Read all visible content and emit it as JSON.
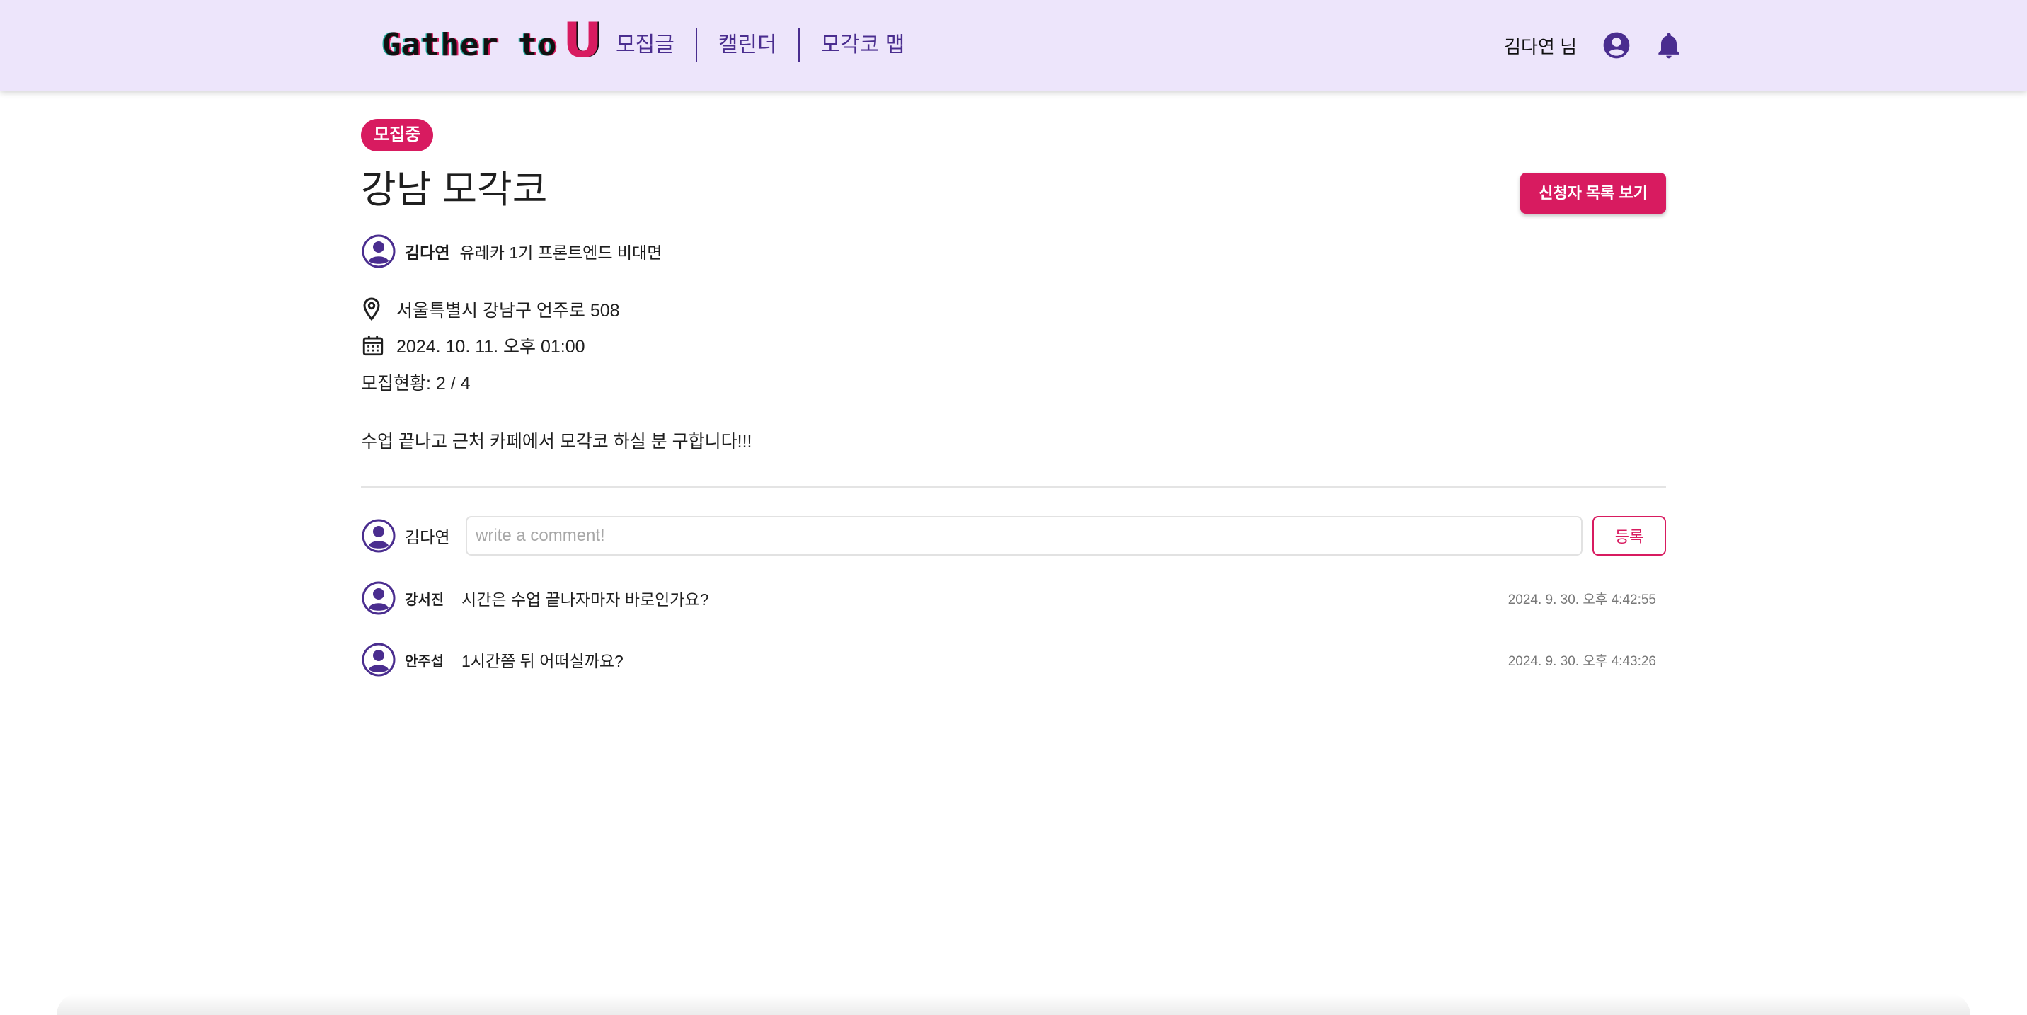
{
  "header": {
    "logo_text": "Gather to",
    "logo_accent": "U",
    "nav": [
      "모집글",
      "캘린더",
      "모각코 맵"
    ],
    "user_label": "김다연 님",
    "profile_icon": "account-circle-icon",
    "notification_icon": "bell-icon"
  },
  "post": {
    "status": "모집중",
    "title": "강남 모각코",
    "applicants_button": "신청자 목록 보기",
    "author": {
      "name": "김다연",
      "description": "유레카 1기 프론트엔드 비대면"
    },
    "location": "서울특별시 강남구 언주로 508",
    "datetime": "2024. 10. 11. 오후 01:00",
    "recruit_status": "모집현황: 2 / 4",
    "content": "수업 끝나고 근처 카페에서 모각코 하실 분 구합니다!!!"
  },
  "comment_form": {
    "user": "김다연",
    "placeholder": "write a comment!",
    "submit_label": "등록"
  },
  "comments": [
    {
      "author": "강서진",
      "text": "시간은 수업 끝나자마자 바로인가요?",
      "time": "2024. 9. 30. 오후 4:42:55"
    },
    {
      "author": "안주섭",
      "text": "1시간쯤 뒤 어떠실까요?",
      "time": "2024. 9. 30. 오후 4:43:26"
    }
  ],
  "colors": {
    "header_bg": "#ede5fb",
    "primary": "#d81b60",
    "nav_text": "#4a2d8f",
    "avatar": "#4a2d8f"
  }
}
